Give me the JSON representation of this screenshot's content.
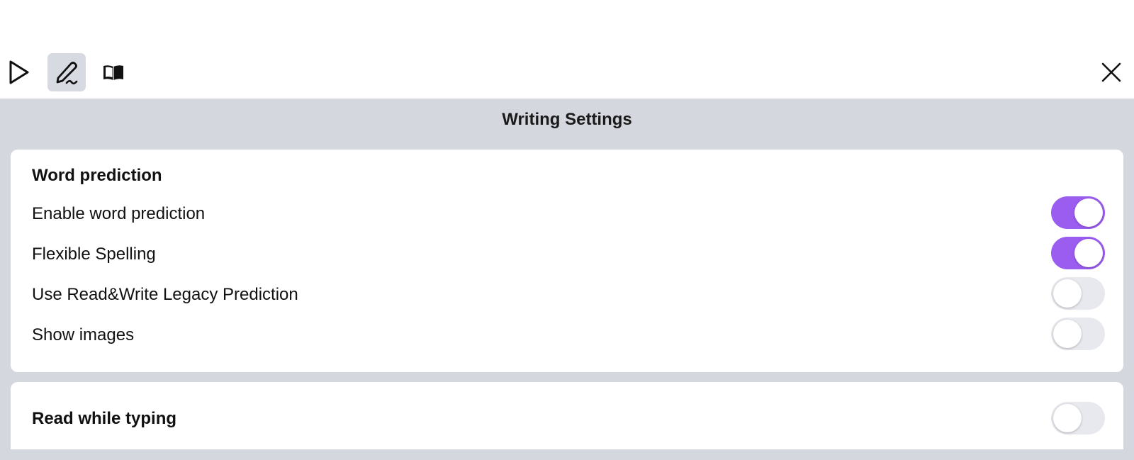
{
  "toolbar": {
    "tools": [
      {
        "name": "play",
        "icon": "play-icon",
        "active": false
      },
      {
        "name": "writing",
        "icon": "pen-icon",
        "active": true
      },
      {
        "name": "reading",
        "icon": "book-icon",
        "active": false
      }
    ],
    "close_icon": "close-icon"
  },
  "panel": {
    "title": "Writing Settings"
  },
  "word_prediction": {
    "section_title": "Word prediction",
    "rows": [
      {
        "label": "Enable word prediction",
        "enabled": true
      },
      {
        "label": "Flexible Spelling",
        "enabled": true
      },
      {
        "label": "Use Read&Write Legacy Prediction",
        "enabled": false
      },
      {
        "label": "Show images",
        "enabled": false
      }
    ]
  },
  "read_while_typing": {
    "label": "Read while typing",
    "enabled": false
  },
  "colors": {
    "toggle_on": "#9b5cf0",
    "toggle_off": "#e8e9ee",
    "panel_bg": "#d5d7df",
    "active_tool_bg": "#d8dae2"
  }
}
